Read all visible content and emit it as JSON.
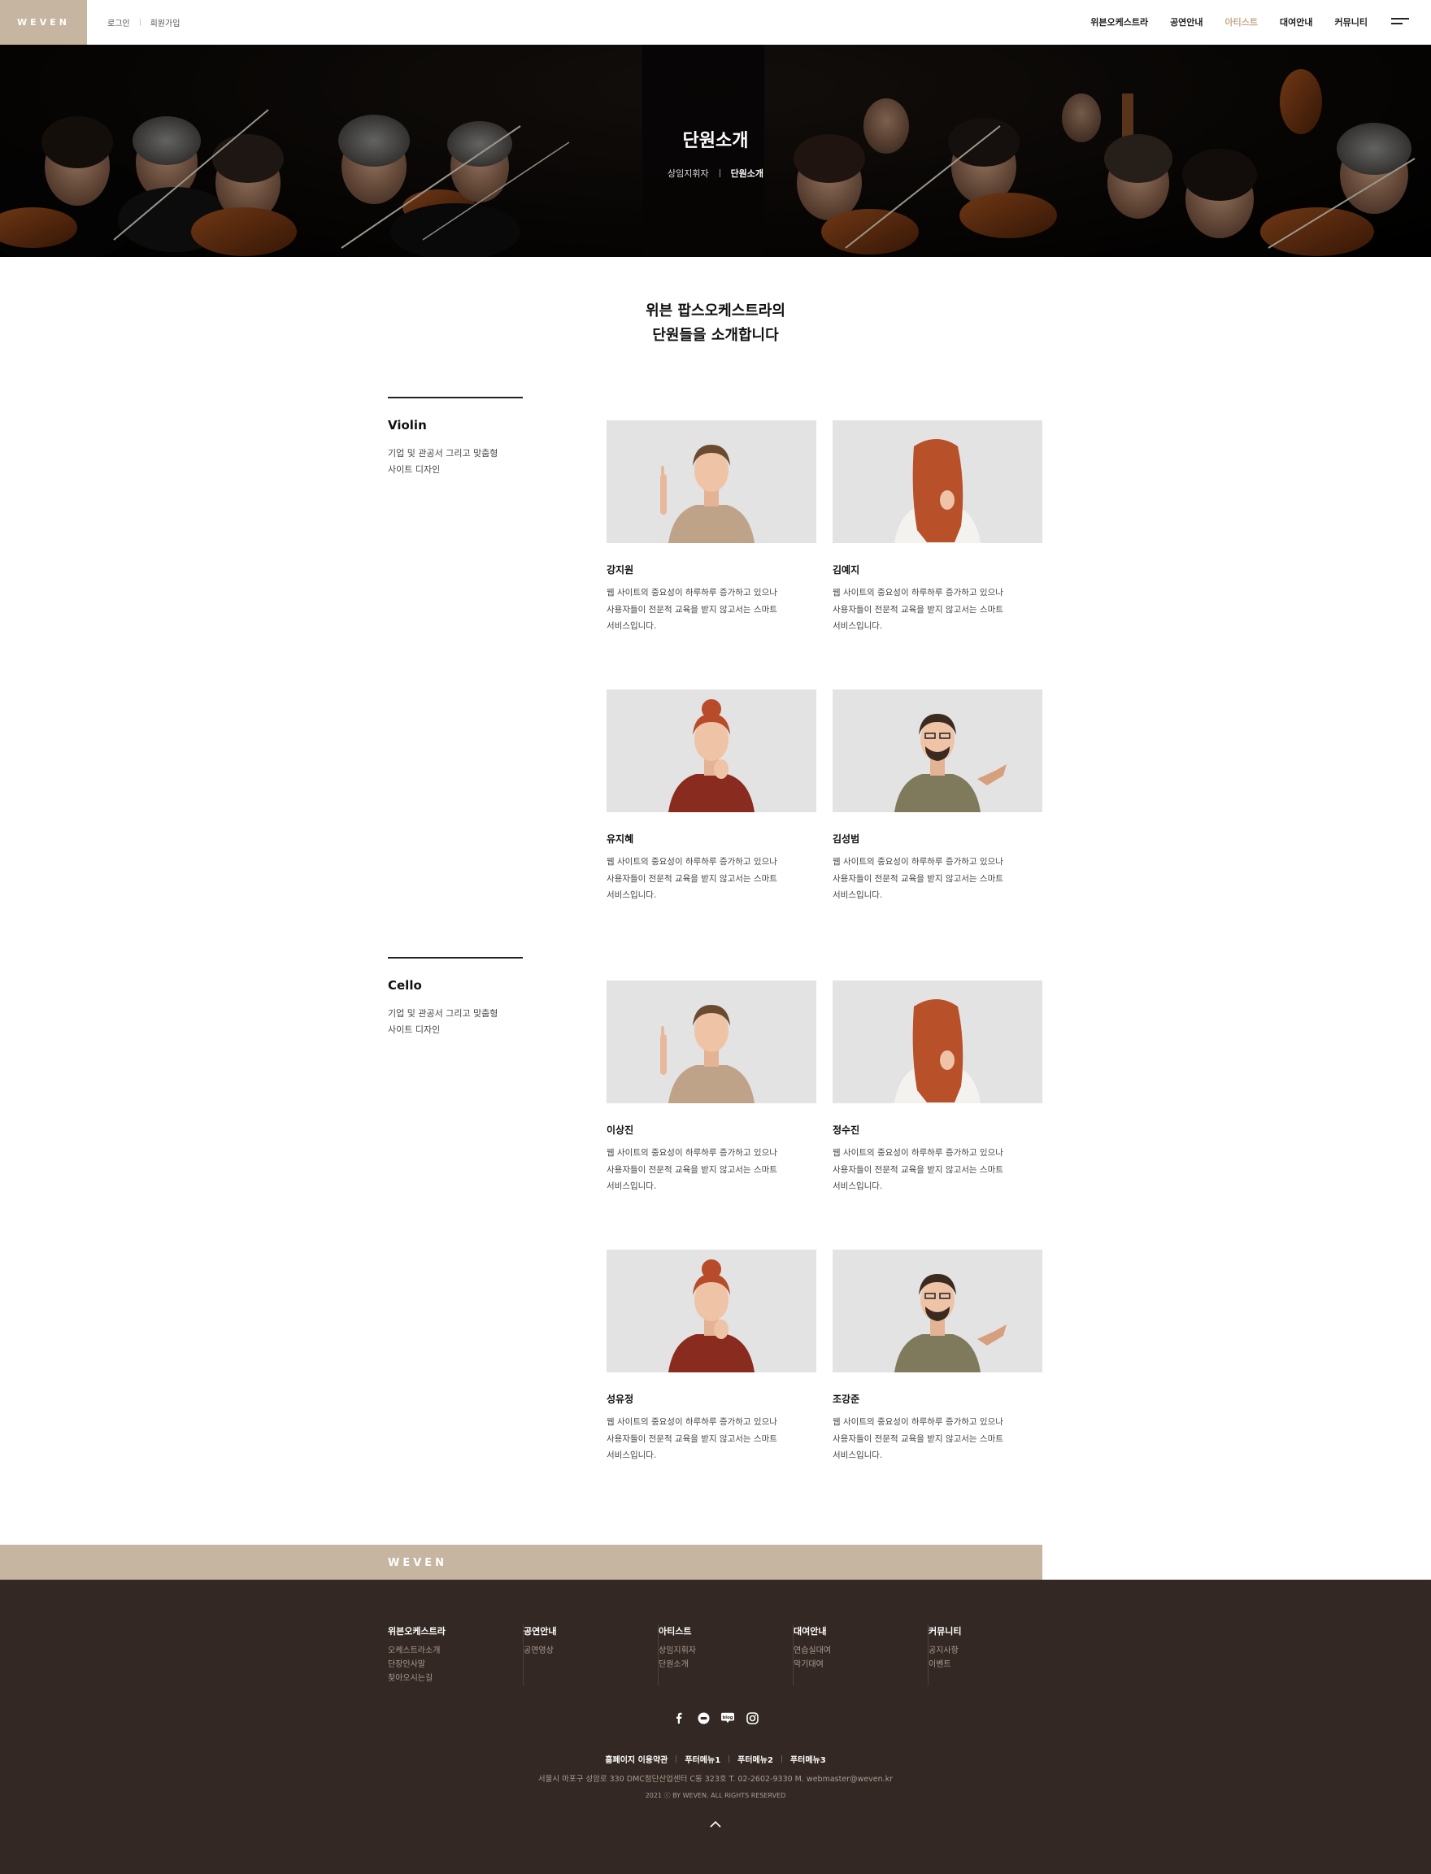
{
  "header": {
    "logo": "WEVEN",
    "login": "로그인",
    "signup": "회원가입",
    "nav": [
      "위븐오케스트라",
      "공연안내",
      "아티스트",
      "대여안내",
      "커뮤니티"
    ],
    "active_index": 2,
    "menu_icon": "hamburger-menu-icon"
  },
  "hero": {
    "title": "단원소개",
    "breadcrumb": [
      "상임지휘자",
      "단원소개"
    ]
  },
  "intro": {
    "line1": "위븐 팝스오케스트라의",
    "line2": "단원들을 소개합니다"
  },
  "sections": [
    {
      "title": "Violin",
      "desc_line1": "기업 및 관공서 그리고 맞춤형",
      "desc_line2": "사이트 디자인",
      "members": [
        {
          "name": "강지원",
          "d1": "웹 사이트의 중요성이 하루하루 증가하고 있으나",
          "d2": "사용자들이 전문적 교육을 받지 않고서는  스마트",
          "d3": "서비스입니다."
        },
        {
          "name": "김예지",
          "d1": "웹 사이트의 중요성이 하루하루 증가하고 있으나",
          "d2": "사용자들이 전문적 교육을 받지 않고서는 스마트",
          "d3": "서비스입니다."
        },
        {
          "name": "유지혜",
          "d1": "웹 사이트의 중요성이 하루하루 증가하고 있으나",
          "d2": "사용자들이 전문적 교육을 받지 않고서는  스마트",
          "d3": "서비스입니다."
        },
        {
          "name": "김성범",
          "d1": "웹 사이트의 중요성이 하루하루 증가하고 있으나",
          "d2": "사용자들이 전문적 교육을 받지 않고서는 스마트",
          "d3": "서비스입니다."
        }
      ]
    },
    {
      "title": "Cello",
      "desc_line1": "기업 및 관공서 그리고 맞춤형",
      "desc_line2": "사이트 디자인",
      "members": [
        {
          "name": "이상진",
          "d1": "웹 사이트의 중요성이 하루하루 증가하고 있으나",
          "d2": "사용자들이 전문적 교육을 받지 않고서는  스마트",
          "d3": "서비스입니다."
        },
        {
          "name": "정수진",
          "d1": "웹 사이트의 중요성이 하루하루 증가하고 있으나",
          "d2": "사용자들이 전문적 교육을 받지 않고서는 스마트",
          "d3": "서비스입니다."
        },
        {
          "name": "성유정",
          "d1": "웹 사이트의 중요성이 하루하루 증가하고 있으나",
          "d2": "사용자들이 전문적 교육을 받지 않고서는  스마트",
          "d3": "서비스입니다."
        },
        {
          "name": "조강준",
          "d1": "웹 사이트의 중요성이 하루하루 증가하고 있으나",
          "d2": "사용자들이 전문적 교육을 받지 않고서는 스마트",
          "d3": "서비스입니다."
        }
      ]
    }
  ],
  "footer": {
    "logo": "WEVEN",
    "columns": [
      {
        "title": "위븐오케스트라",
        "links": [
          "오케스트라소개",
          "단장인사말",
          "찾아오시는길"
        ]
      },
      {
        "title": "공연안내",
        "links": [
          "공연영상"
        ]
      },
      {
        "title": "아티스트",
        "links": [
          "상임지휘자",
          "단원소개"
        ]
      },
      {
        "title": "대여안내",
        "links": [
          "연습실대여",
          "악기대여"
        ]
      },
      {
        "title": "커뮤니티",
        "links": [
          "공지사항",
          "이벤트"
        ]
      }
    ],
    "sns": [
      "facebook-icon",
      "chat-icon",
      "blog-icon",
      "instagram-icon"
    ],
    "sns_blog_label": "blog",
    "links": [
      "홈페이지 이용약관",
      "푸터메뉴1",
      "푸터메뉴2",
      "푸터메뉴3"
    ],
    "address": "서울시 마포구 성암로 330 DMC첨단산업센터 C동 323호   T. 02-2602-9330   M. webmaster@weven.kr",
    "copyright": "2021 ⓒ BY WEVEN. ALL RIGHTS RESERVED"
  },
  "colors": {
    "accent": "#c6b5a1",
    "nav_active": "#c6a98a",
    "footer_bg": "#332823"
  }
}
